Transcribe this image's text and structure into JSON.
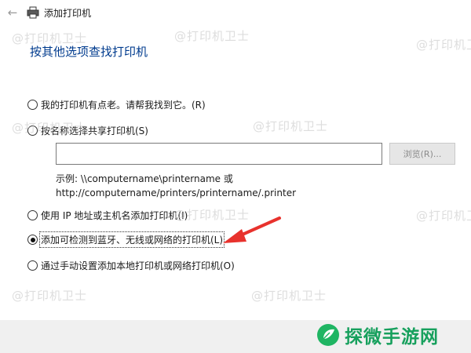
{
  "window": {
    "title": "添加打印机"
  },
  "heading": "按其他选项查找打印机",
  "options": [
    {
      "label": "我的打印机有点老。请帮我找到它。(R)",
      "checked": false
    },
    {
      "label": "按名称选择共享打印机(S)",
      "checked": false
    },
    {
      "label": "使用 IP 地址或主机名添加打印机(I)",
      "checked": false
    },
    {
      "label": "添加可检测到蓝牙、无线或网络的打印机(L)",
      "checked": true
    },
    {
      "label": "通过手动设置添加本地打印机或网络打印机(O)",
      "checked": false
    }
  ],
  "shared_printer": {
    "value": "",
    "browse_label": "浏览(R)..."
  },
  "example": {
    "line1": "示例: \\\\computername\\printername 或",
    "line2": "http://computername/printers/printername/.printer"
  },
  "watermark": "@打印机卫士",
  "brand": {
    "text": "探微手游网"
  },
  "colors": {
    "heading": "#003b8e",
    "arrow": "#e8322d",
    "brand": "#17a05d"
  },
  "icons": [
    "back-arrow-icon",
    "printer-icon",
    "red-arrow-icon",
    "brand-logo-icon"
  ]
}
